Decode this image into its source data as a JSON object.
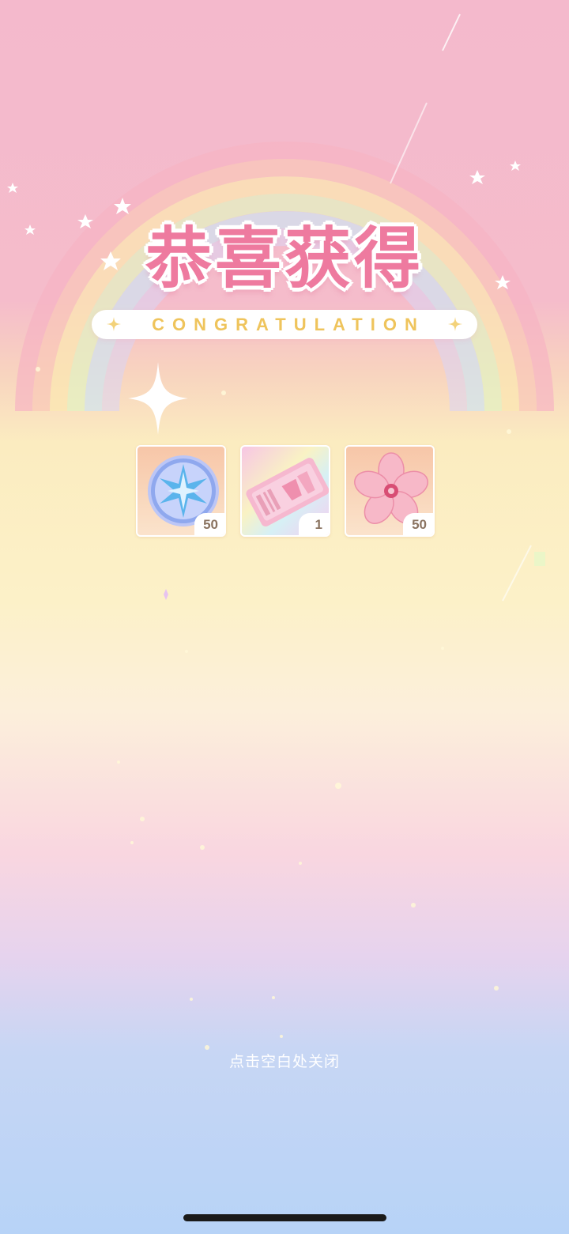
{
  "title": "恭喜获得",
  "subtitle": "CONGRATULATION",
  "rewards": [
    {
      "name": "star-coin",
      "count": "50"
    },
    {
      "name": "ticket",
      "count": "1"
    },
    {
      "name": "sakura-flower",
      "count": "50"
    }
  ],
  "close_hint": "点击空白处关闭",
  "colors": {
    "title": "#ee7a9f",
    "subtitle": "#efc45c",
    "count_text": "#8a7360"
  }
}
